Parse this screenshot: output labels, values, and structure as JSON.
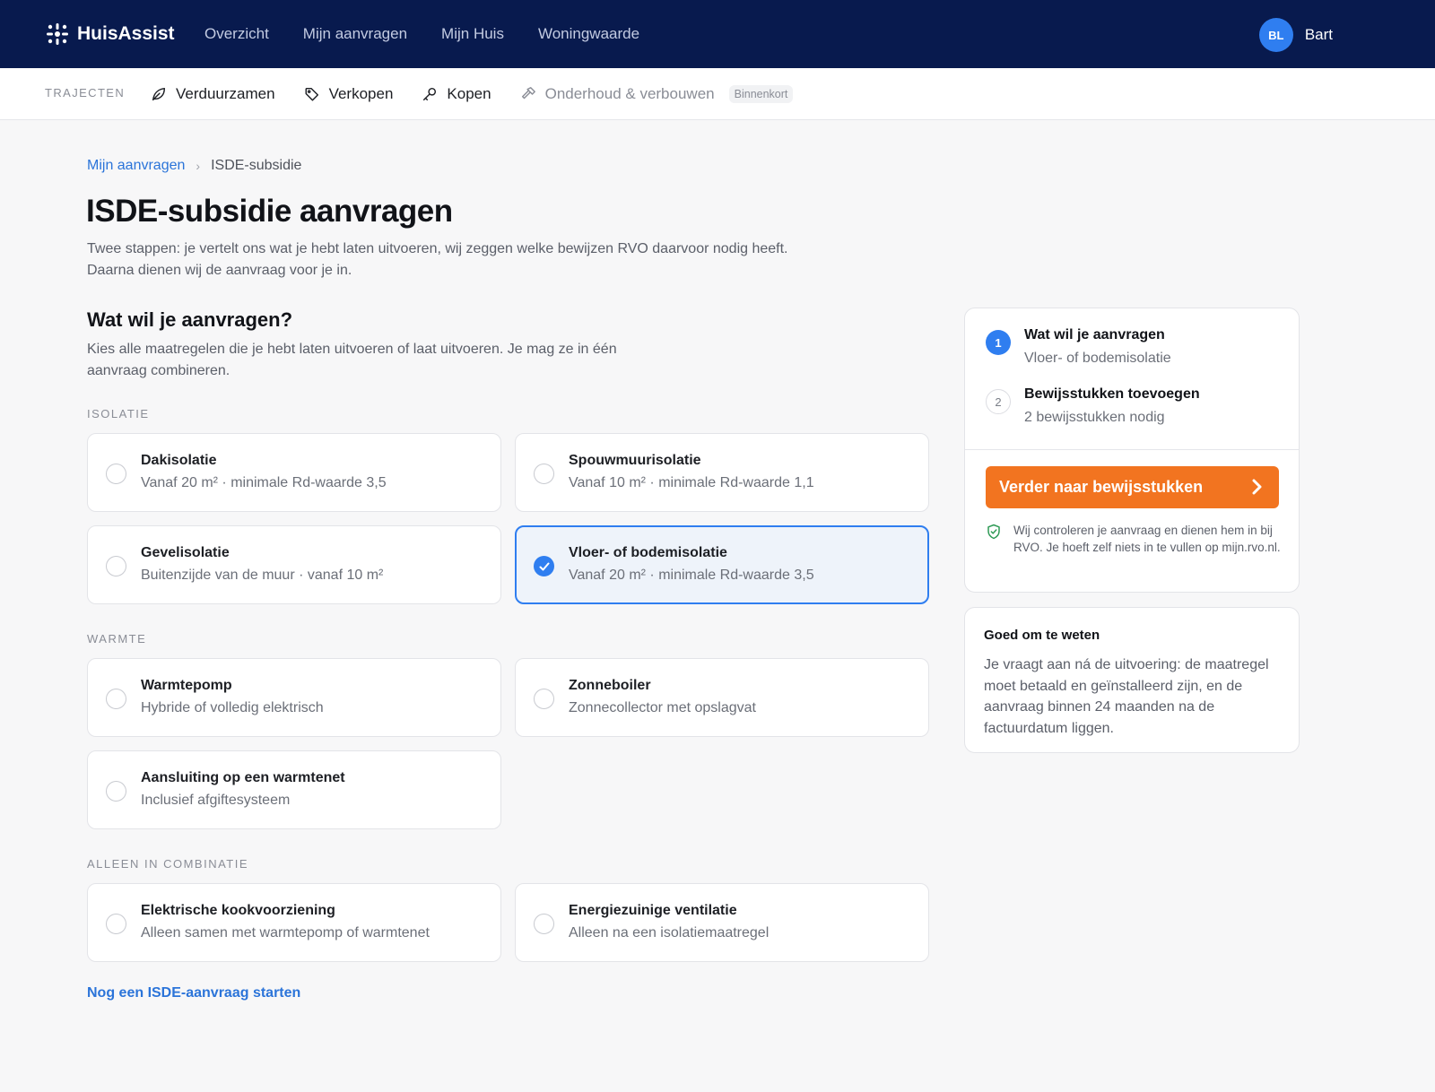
{
  "brand": {
    "name": "HuisAssist"
  },
  "topnav": {
    "links": [
      "Overzicht",
      "Mijn aanvragen",
      "Mijn Huis",
      "Woningwaarde"
    ]
  },
  "user": {
    "initials": "BL",
    "name": "Bart"
  },
  "subnav": {
    "label": "TRAJECTEN",
    "items": [
      {
        "label": "Verduurzamen",
        "icon": "leaf-icon"
      },
      {
        "label": "Verkopen",
        "icon": "tag-icon"
      },
      {
        "label": "Kopen",
        "icon": "key-icon"
      },
      {
        "label": "Onderhoud & verbouwen",
        "icon": "hammer-icon",
        "badge": "Binnenkort",
        "disabled": true
      }
    ]
  },
  "breadcrumb": {
    "parent": "Mijn aanvragen",
    "separator": "›",
    "current": "ISDE-subsidie"
  },
  "page": {
    "title": "ISDE-subsidie aanvragen",
    "intro": "Twee stappen: je vertelt ons wat je hebt laten uitvoeren, wij zeggen welke bewijzen RVO daarvoor nodig heeft. Daarna dienen wij de aanvraag voor je in."
  },
  "question": {
    "title": "Wat wil je aanvragen?",
    "intro": "Kies alle maatregelen die je hebt laten uitvoeren of laat uitvoeren. Je mag ze in één aanvraag combineren."
  },
  "groups": [
    {
      "label": "ISOLATIE",
      "options": [
        {
          "title": "Dakisolatie",
          "sub": "Vanaf 20 m² · minimale Rd-waarde 3,5",
          "checked": false
        },
        {
          "title": "Spouwmuurisolatie",
          "sub": "Vanaf 10 m² · minimale Rd-waarde 1,1",
          "checked": false
        },
        {
          "title": "Gevelisolatie",
          "sub": "Buitenzijde van de muur · vanaf 10 m²",
          "checked": false
        },
        {
          "title": "Vloer- of bodemisolatie",
          "sub": "Vanaf 20 m² · minimale Rd-waarde 3,5",
          "checked": true
        }
      ]
    },
    {
      "label": "WARMTE",
      "options": [
        {
          "title": "Warmtepomp",
          "sub": "Hybride of volledig elektrisch",
          "checked": false
        },
        {
          "title": "Zonneboiler",
          "sub": "Zonnecollector met opslagvat",
          "checked": false
        },
        {
          "title": "Aansluiting op een warmtenet",
          "sub": "Inclusief afgiftesysteem",
          "checked": false
        }
      ]
    },
    {
      "label": "ALLEEN IN COMBINATIE",
      "options": [
        {
          "title": "Elektrische kookvoorziening",
          "sub": "Alleen samen met warmtepomp of warmtenet",
          "checked": false
        },
        {
          "title": "Energiezuinige ventilatie",
          "sub": "Alleen na een isolatiemaatregel",
          "checked": false
        }
      ]
    }
  ],
  "restart_link": "Nog een ISDE-aanvraag starten",
  "steps": [
    {
      "num": "1",
      "title": "Wat wil je aanvragen",
      "sub": "Vloer- of bodemisolatie",
      "active": true
    },
    {
      "num": "2",
      "title": "Bewijsstukken toevoegen",
      "sub": "2 bewijsstukken nodig",
      "active": false
    }
  ],
  "cta": {
    "label": "Verder naar bewijsstukken",
    "color": "#f27420"
  },
  "note": "Wij controleren je aanvraag en dienen hem in bij RVO. Je hoeft zelf niets in te vullen op mijn.rvo.nl.",
  "info": {
    "title": "Goed om te weten",
    "body": "Je vraagt aan ná de uitvoering: de maatregel moet betaald en geïnstalleerd zijn, en de aanvraag binnen 24 maanden na de factuurdatum liggen."
  },
  "colors": {
    "nav_bg": "#081a4e",
    "accent": "#2f7ef0",
    "cta": "#f27420",
    "link": "#2b74d9"
  }
}
